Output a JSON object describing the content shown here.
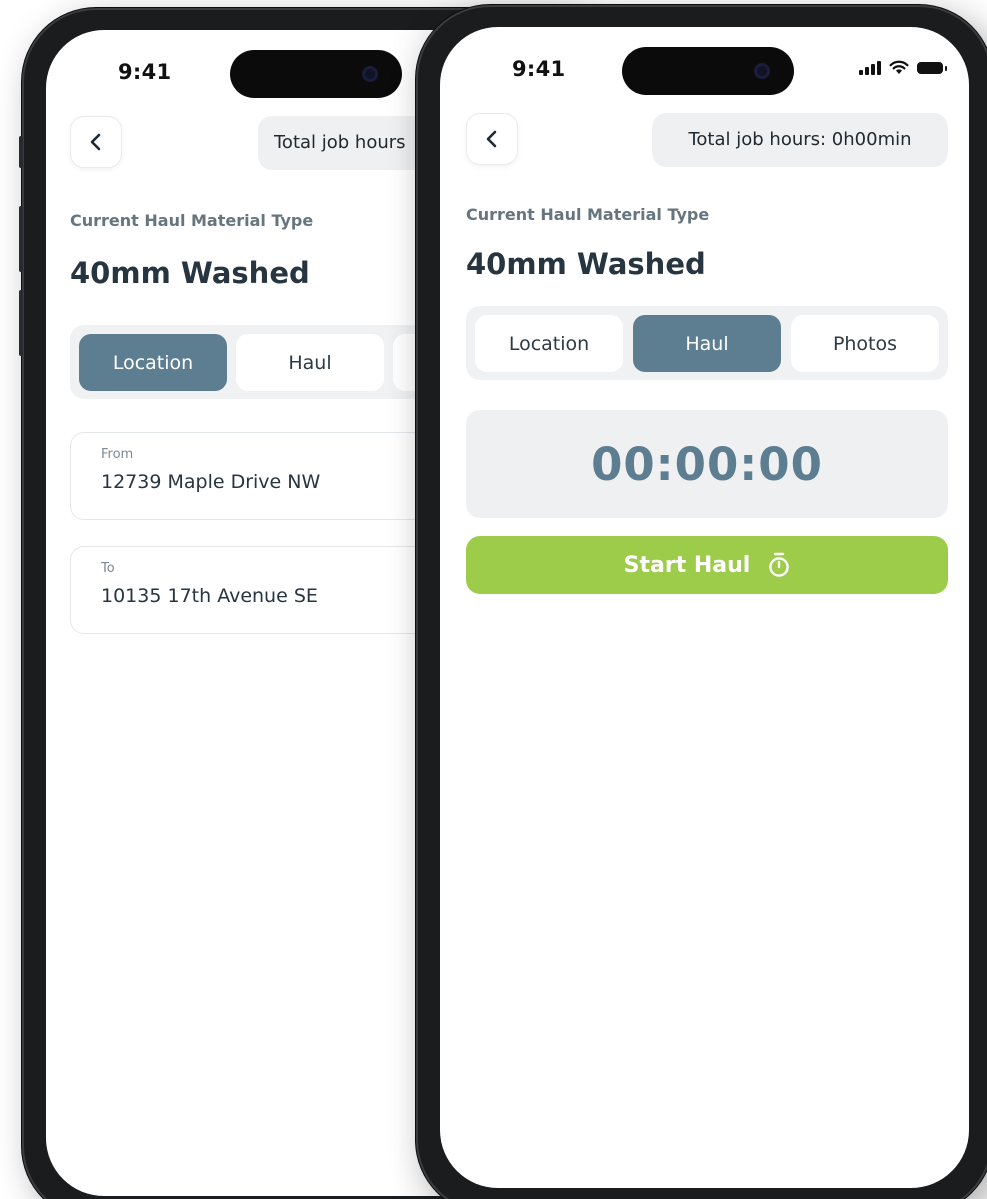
{
  "status_bar": {
    "time": "9:41"
  },
  "header": {
    "total_hours_label": "Total job hours: 0h00min",
    "total_hours_label_clipped": "Total job hours"
  },
  "material": {
    "label": "Current Haul Material Type",
    "value": "40mm Washed"
  },
  "tabs": [
    {
      "label": "Location"
    },
    {
      "label": "Haul"
    },
    {
      "label": "Photos"
    }
  ],
  "back_screen": {
    "active_tab": "Location",
    "from": {
      "label": "From",
      "value": "12739 Maple Drive NW"
    },
    "to": {
      "label": "To",
      "value": "10135 17th Avenue SE"
    }
  },
  "front_screen": {
    "active_tab": "Haul",
    "timer": "00:00:00",
    "start_button": "Start Haul"
  },
  "colors": {
    "accent": "#5d7d90",
    "start_green": "#9ccc4a",
    "title": "#26353f",
    "muted": "#66757f",
    "panel": "#eef0f2"
  },
  "icons": {
    "back": "chevron-left-icon",
    "stopwatch": "stopwatch-icon",
    "signal": "signal-icon",
    "wifi": "wifi-icon",
    "battery": "battery-icon"
  }
}
